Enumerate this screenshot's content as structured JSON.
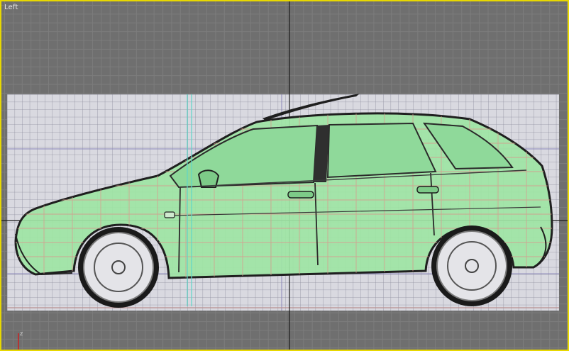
{
  "viewport": {
    "label": "Left",
    "axis_label": "z",
    "colors": {
      "border": "#e8d800",
      "background": "#6f6f6f",
      "grid_minor": "#7c7c7c",
      "home_grid": "#1a1a1a",
      "blueprint_bg": "#d9d9e0",
      "blueprint_grid": "#8e8e9e",
      "car_body": "#9ee5a4",
      "wire": "#d89b8e",
      "outline": "#1f1f1f",
      "cyan_line": "#5fd6c8"
    },
    "scene": {
      "blueprint_name": "side-reference-plane",
      "model_name": "hatchback-car-mesh"
    }
  }
}
